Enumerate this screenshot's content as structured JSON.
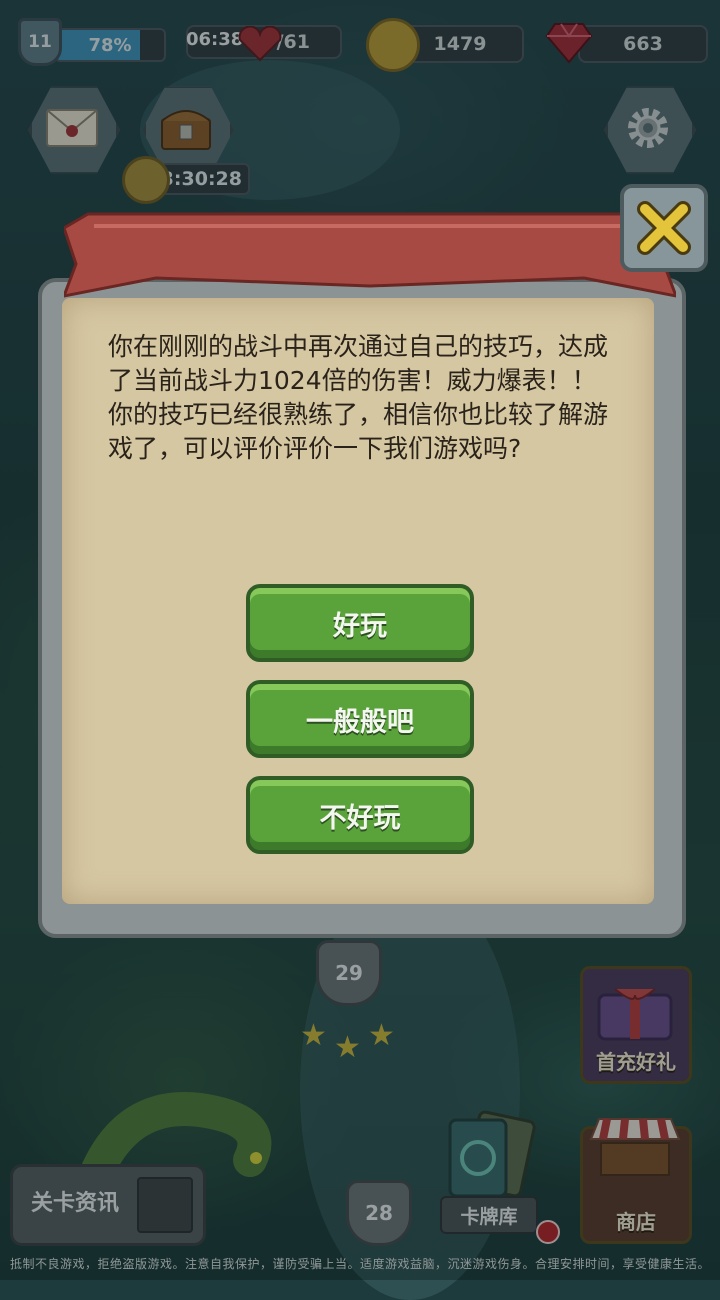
{
  "hud": {
    "player_level": "11",
    "xp_percent_label": "78%",
    "xp_fraction": 0.78,
    "energy_timer": "06:38",
    "energy": "30/61",
    "gold": "1479",
    "gems": "663",
    "chest_timer": "3:30:28"
  },
  "icons": {
    "mail": "mail-icon",
    "chest": "treasure-chest-icon",
    "settings": "gear-icon",
    "close": "close-icon",
    "coin": "coin-icon",
    "heart": "heart-icon",
    "gem": "gem-icon",
    "clock": "clock-icon"
  },
  "dialog": {
    "message": "你在刚刚的战斗中再次通过自己的技巧，达成了当前战斗力1024倍的伤害！威力爆表！！\n你的技巧已经很熟练了，相信你也比较了解游戏了，可以评价评价一下我们游戏吗?",
    "options": [
      "好玩",
      "一般般吧",
      "不好玩"
    ]
  },
  "map": {
    "stage_upper": "29",
    "stage_lower": "28",
    "stars": 3
  },
  "buttons": {
    "first_recharge": "首充好礼",
    "shop": "商店",
    "card_library": "卡牌库",
    "level_info": "关卡资讯"
  },
  "footer": "抵制不良游戏，拒绝盗版游戏。注意自我保护，谨防受骗上当。适度游戏益脑，沉迷游戏伤身。合理安排时间，享受健康生活。"
}
